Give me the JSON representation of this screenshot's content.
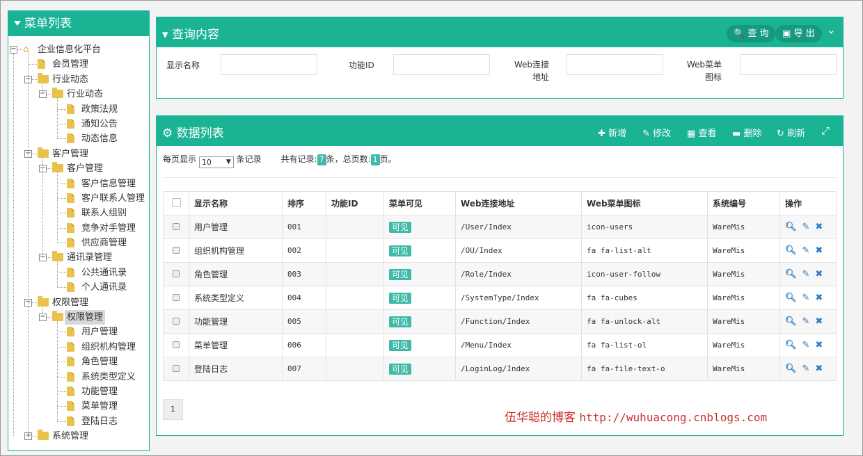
{
  "sidebar": {
    "title": "菜单列表",
    "tree": [
      {
        "label": "企业信息化平台",
        "level": 0,
        "type": "home",
        "toggle": "-"
      },
      {
        "label": "会员管理",
        "level": 1,
        "type": "doc"
      },
      {
        "label": "行业动态",
        "level": 1,
        "type": "folder",
        "toggle": "-"
      },
      {
        "label": "行业动态",
        "level": 2,
        "type": "folder",
        "toggle": "-"
      },
      {
        "label": "政策法规",
        "level": 3,
        "type": "doc"
      },
      {
        "label": "通知公告",
        "level": 3,
        "type": "doc"
      },
      {
        "label": "动态信息",
        "level": 3,
        "type": "doc"
      },
      {
        "label": "客户管理",
        "level": 1,
        "type": "folder",
        "toggle": "-"
      },
      {
        "label": "客户管理",
        "level": 2,
        "type": "folder",
        "toggle": "-"
      },
      {
        "label": "客户信息管理",
        "level": 3,
        "type": "doc"
      },
      {
        "label": "客户联系人管理",
        "level": 3,
        "type": "doc"
      },
      {
        "label": "联系人组别",
        "level": 3,
        "type": "doc"
      },
      {
        "label": "竞争对手管理",
        "level": 3,
        "type": "doc"
      },
      {
        "label": "供应商管理",
        "level": 3,
        "type": "doc"
      },
      {
        "label": "通讯录管理",
        "level": 2,
        "type": "folder",
        "toggle": "-"
      },
      {
        "label": "公共通讯录",
        "level": 3,
        "type": "doc"
      },
      {
        "label": "个人通讯录",
        "level": 3,
        "type": "doc"
      },
      {
        "label": "权限管理",
        "level": 1,
        "type": "folder",
        "toggle": "-"
      },
      {
        "label": "权限管理",
        "level": 2,
        "type": "folder",
        "toggle": "-",
        "selected": true
      },
      {
        "label": "用户管理",
        "level": 3,
        "type": "doc"
      },
      {
        "label": "组织机构管理",
        "level": 3,
        "type": "doc"
      },
      {
        "label": "角色管理",
        "level": 3,
        "type": "doc"
      },
      {
        "label": "系统类型定义",
        "level": 3,
        "type": "doc"
      },
      {
        "label": "功能管理",
        "level": 3,
        "type": "doc"
      },
      {
        "label": "菜单管理",
        "level": 3,
        "type": "doc"
      },
      {
        "label": "登陆日志",
        "level": 3,
        "type": "doc"
      },
      {
        "label": "系统管理",
        "level": 1,
        "type": "folder",
        "toggle": "+"
      }
    ]
  },
  "query": {
    "title": "查询内容",
    "search_label": "查 询",
    "export_label": "导 出",
    "fields": [
      {
        "label": "显示名称",
        "value": ""
      },
      {
        "label": "功能ID",
        "value": ""
      },
      {
        "label_line1": "Web连接",
        "label_line2": "地址",
        "value": ""
      },
      {
        "label_line1": "Web菜单",
        "label_line2": "图标",
        "value": ""
      }
    ]
  },
  "data_panel": {
    "title": "数据列表",
    "toolbar": {
      "add": "新增",
      "edit": "修改",
      "view": "查看",
      "delete": "删除",
      "refresh": "刷新"
    },
    "pager": {
      "per_page_prefix": "每页显示",
      "per_page_value": "10",
      "per_page_suffix": "条记录",
      "total_prefix": "共有记录:",
      "total_records": "7",
      "total_mid": "条，总页数:",
      "total_pages": "1",
      "total_suffix": "页。"
    },
    "columns": [
      "显示名称",
      "排序",
      "功能ID",
      "菜单可见",
      "Web连接地址",
      "Web菜单图标",
      "系统编号",
      "操作"
    ],
    "rows": [
      {
        "name": "用户管理",
        "sort": "001",
        "func_id": "",
        "visible": "可见",
        "url": "/User/Index",
        "icon": "icon-users",
        "sys": "WareMis"
      },
      {
        "name": "组织机构管理",
        "sort": "002",
        "func_id": "",
        "visible": "可见",
        "url": "/OU/Index",
        "icon": "fa fa-list-alt",
        "sys": "WareMis"
      },
      {
        "name": "角色管理",
        "sort": "003",
        "func_id": "",
        "visible": "可见",
        "url": "/Role/Index",
        "icon": "icon-user-follow",
        "sys": "WareMis"
      },
      {
        "name": "系统类型定义",
        "sort": "004",
        "func_id": "",
        "visible": "可见",
        "url": "/SystemType/Index",
        "icon": "fa fa-cubes",
        "sys": "WareMis"
      },
      {
        "name": "功能管理",
        "sort": "005",
        "func_id": "",
        "visible": "可见",
        "url": "/Function/Index",
        "icon": "fa fa-unlock-alt",
        "sys": "WareMis"
      },
      {
        "name": "菜单管理",
        "sort": "006",
        "func_id": "",
        "visible": "可见",
        "url": "/Menu/Index",
        "icon": "fa fa-list-ol",
        "sys": "WareMis"
      },
      {
        "name": "登陆日志",
        "sort": "007",
        "func_id": "",
        "visible": "可见",
        "url": "/LoginLog/Index",
        "icon": "fa fa-file-text-o",
        "sys": "WareMis"
      }
    ],
    "current_page": "1"
  },
  "watermark": {
    "author": "伍华聪的博客",
    "url": "http://wuhuacong.cnblogs.com"
  },
  "colors": {
    "accent": "#1ab394",
    "badge": "#3fb9a8",
    "action_icon": "#2f7bbf",
    "watermark": "#c9302c"
  }
}
